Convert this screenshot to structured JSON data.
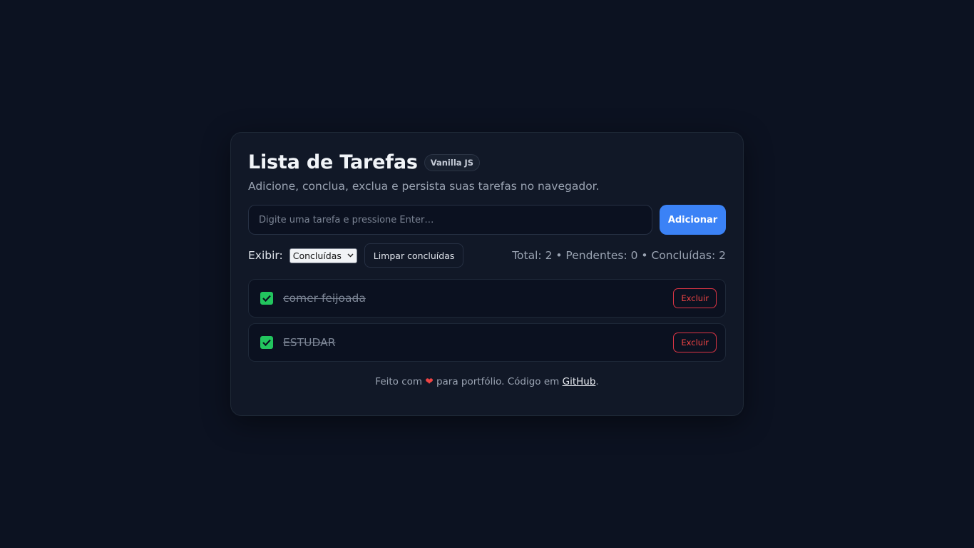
{
  "header": {
    "title": "Lista de Tarefas",
    "badge": "Vanilla JS",
    "subtitle": "Adicione, conclua, exclua e persista suas tarefas no navegador."
  },
  "input": {
    "placeholder": "Digite uma tarefa e pressione Enter…",
    "value": "",
    "add_label": "Adicionar"
  },
  "filter": {
    "label": "Exibir:",
    "selected": "Concluídas",
    "clear_label": "Limpar concluídas"
  },
  "stats": {
    "text": "Total: 2 • Pendentes: 0 • Concluídas: 2"
  },
  "tasks": [
    {
      "text": "comer feijoada",
      "done": true,
      "delete_label": "Excluir"
    },
    {
      "text": "ESTUDAR",
      "done": true,
      "delete_label": "Excluir"
    }
  ],
  "footer": {
    "prefix": "Feito com",
    "heart": "❤",
    "middle": "para portfólio. Código em",
    "link": "GitHub",
    "suffix": "."
  },
  "colors": {
    "background": "#0c1221",
    "card": "#111827",
    "accent": "#3b82f6",
    "check": "#22c55e",
    "danger": "#ef4444"
  },
  "icons": {
    "checkbox": "checkmark-icon",
    "select": "chevron-down-icon",
    "heart": "heart-icon"
  }
}
